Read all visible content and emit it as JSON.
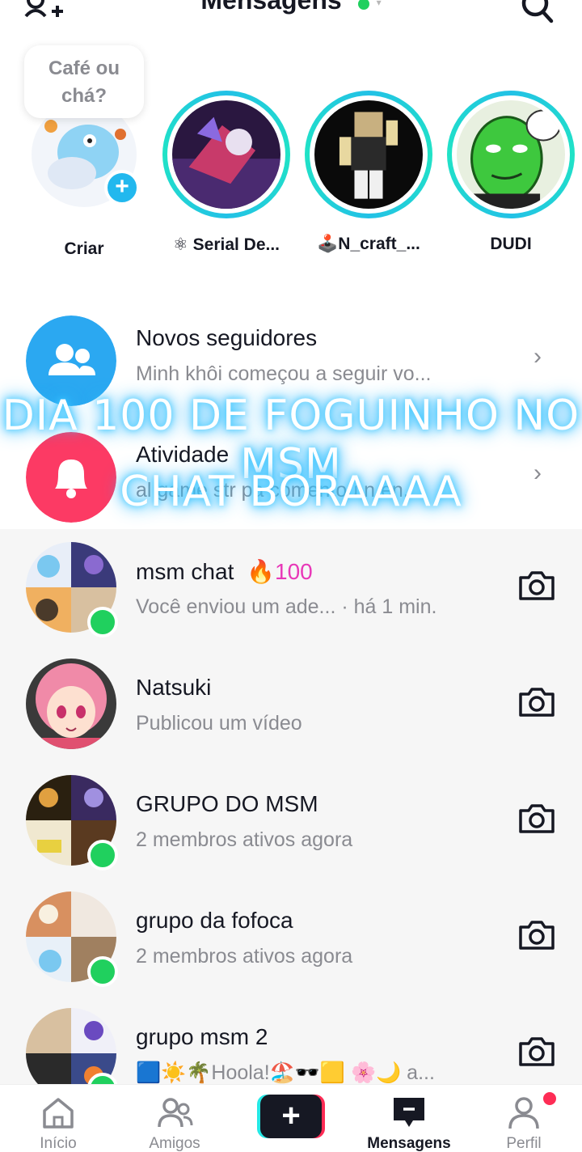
{
  "header": {
    "title": "Mensagens"
  },
  "stories": {
    "note": "Café ou chá?",
    "items": [
      {
        "label": "Criar"
      },
      {
        "label": "⚛ Serial De..."
      },
      {
        "label": "🕹️N_craft_..."
      },
      {
        "label": "DUDI"
      }
    ]
  },
  "system": {
    "followers": {
      "title": "Novos seguidores",
      "subtitle": "Minh khôi começou a seguir vo..."
    },
    "activity": {
      "title": "Atividade",
      "subtitle": "al game str pa comentou n en..."
    }
  },
  "overlay": {
    "line1": "DIA 100 DE FOGUINHO NO MSM",
    "line2": "CHAT BORAAAA"
  },
  "chats": [
    {
      "name": "msm chat",
      "streak": "100",
      "subtitle": "Você enviou um ade...  · há 1 min.",
      "online": true
    },
    {
      "name": "Natsuki",
      "subtitle": "Publicou um vídeo",
      "online": false
    },
    {
      "name": "GRUPO DO MSM",
      "subtitle": "2 membros ativos agora",
      "online": true
    },
    {
      "name": "grupo da fofoca",
      "subtitle": "2 membros ativos agora",
      "online": true
    },
    {
      "name": "grupo msm 2",
      "subtitle": "🟦☀️🌴Hoola!🏖️🕶️🟨 🌸🌙 a...",
      "online": true
    }
  ],
  "nav": {
    "items": [
      {
        "label": "Início"
      },
      {
        "label": "Amigos"
      },
      {
        "label": "Mensagens"
      },
      {
        "label": "Perfil"
      }
    ]
  },
  "colors": {
    "accent_cyan": "#22c1e6",
    "followers_blue": "#2ba8f1",
    "activity_red": "#fc3a64",
    "online_green": "#20d05e",
    "streak_pink": "#e838b8",
    "brand_red": "#fe2c55"
  }
}
